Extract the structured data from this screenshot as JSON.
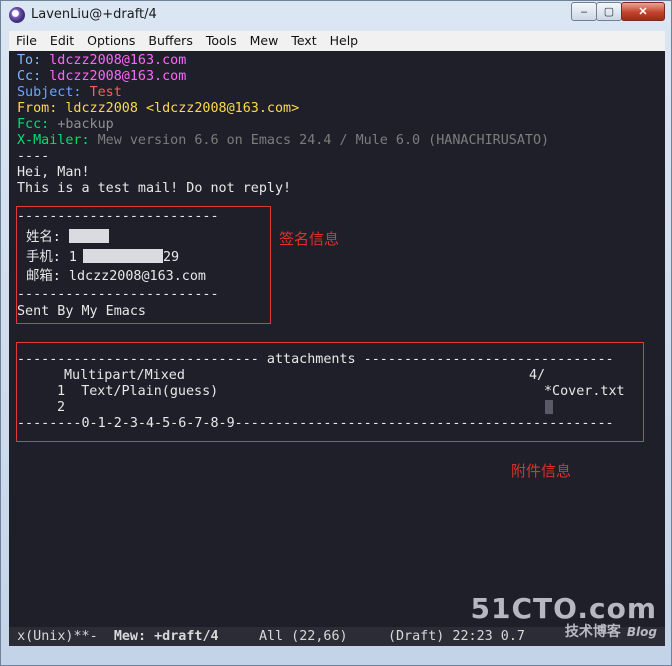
{
  "window": {
    "title": "LavenLiu@+draft/4",
    "min": "–",
    "max": "▢",
    "close": "✕"
  },
  "menu": [
    "File",
    "Edit",
    "Options",
    "Buffers",
    "Tools",
    "Mew",
    "Text",
    "Help"
  ],
  "mail": {
    "to_label": "To:",
    "to_value": "ldczz2008@163.com",
    "cc_label": "Cc:",
    "cc_value": "ldczz2008@163.com",
    "subject_label": "Subject:",
    "subject_value": "Test",
    "from_label": "From:",
    "from_value": "ldczz2008 <ldczz2008@163.com>",
    "fcc_label": "Fcc:",
    "fcc_value": "+backup",
    "xmailer_label": "X-Mailer:",
    "xmailer_value": "Mew version 6.6 on Emacs 24.4 / Mule 6.0 (HANACHIRUSATO)",
    "separator": "----",
    "body_lines": [
      "Hei, Man!",
      "This is a test mail! Do not reply!"
    ]
  },
  "signature": {
    "rule": "-------------------------",
    "name_label": "姓名:",
    "phone_label": "手机: 1",
    "phone_tail": "29",
    "email_line": "邮箱: ldczz2008@163.com",
    "footer": "Sent By My Emacs"
  },
  "attachments": {
    "header": "------------------------------ attachments -------------------------------",
    "row_type": "Multipart/Mixed",
    "row_type_num": "4/",
    "row1_num": "1",
    "row1_type": "Text/Plain(guess)",
    "row1_file": "*Cover.txt",
    "row2_num": "2",
    "footer": "--------0-1-2-3-4-5-6-7-8-9-----------------------------------------------"
  },
  "annotations": {
    "signature": "签名信息",
    "attachments": "附件信息"
  },
  "modeline": {
    "left": "x(Unix)**-",
    "mode": "Mew: +draft/4",
    "pos": "All (22,66)",
    "rest": "(Draft) 22:23 0.7"
  },
  "watermark": {
    "site": "51CTO.com",
    "cn": "技术博客",
    "blog": "Blog"
  }
}
